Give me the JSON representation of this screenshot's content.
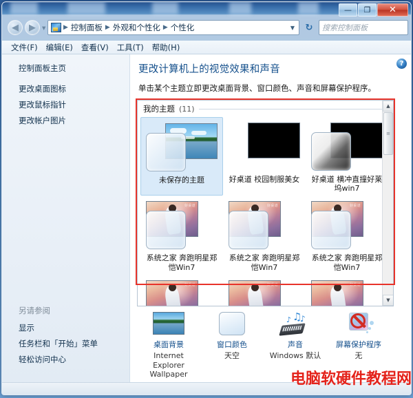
{
  "window": {
    "controls": {
      "minimize": "—",
      "maximize": "❐",
      "close": "✕"
    }
  },
  "addressbar": {
    "back_icon": "back-arrow",
    "forward_icon": "forward-arrow",
    "dropdown_icon": "▼",
    "crumbs": [
      "控制面板",
      "外观和个性化",
      "个性化"
    ],
    "separator": "▶",
    "refresh_icon": "↻"
  },
  "search": {
    "placeholder": "搜索控制面板",
    "value": "",
    "icon": "search-icon"
  },
  "menubar": {
    "items": [
      "文件(F)",
      "编辑(E)",
      "查看(V)",
      "工具(T)",
      "帮助(H)"
    ]
  },
  "sidebar": {
    "home": "控制面板主页",
    "links": [
      "更改桌面图标",
      "更改鼠标指针",
      "更改帐户图片"
    ],
    "see_also_label": "另请参阅",
    "see_also": [
      "显示",
      "任务栏和「开始」菜单",
      "轻松访问中心"
    ]
  },
  "main": {
    "help_icon": "?",
    "title": "更改计算机上的视觉效果和声音",
    "subtitle": "单击某个主题立即更改桌面背景、窗口颜色、声音和屏幕保护程序。",
    "group": {
      "name": "我的主题",
      "count": "(11)"
    },
    "themes": [
      {
        "label": "未保存的主题",
        "thumb": "lake",
        "selected": true,
        "preview": "light",
        "watermark": ""
      },
      {
        "label": "好桌道 校园制服美女",
        "thumb": "black",
        "selected": false,
        "preview": "none",
        "watermark": ""
      },
      {
        "label": "好桌道 横冲直撞好莱坞win7",
        "thumb": "black",
        "selected": false,
        "preview": "dark",
        "watermark": ""
      },
      {
        "label": "系统之家 奔跑明星郑恺Win7",
        "thumb": "star",
        "selected": false,
        "preview": "light",
        "watermark": "好桌道"
      },
      {
        "label": "系统之家 奔跑明星郑恺Win7",
        "thumb": "star",
        "selected": false,
        "preview": "light",
        "watermark": "好桌道"
      },
      {
        "label": "系统之家 奔跑明星郑恺Win7",
        "thumb": "star",
        "selected": false,
        "preview": "light",
        "watermark": "好桌道"
      },
      {
        "label": "",
        "thumb": "star",
        "selected": false,
        "preview": "none",
        "watermark": "好桌道"
      },
      {
        "label": "",
        "thumb": "star",
        "selected": false,
        "preview": "none",
        "watermark": "好桌道"
      },
      {
        "label": "",
        "thumb": "star",
        "selected": false,
        "preview": "none",
        "watermark": "好桌道"
      }
    ],
    "scroll": {
      "up": "▲",
      "down": "▼",
      "grip": "≡"
    }
  },
  "options": [
    {
      "name": "桌面背景",
      "value": "Internet Explorer Wallpaper",
      "icon": "wallpaper-icon"
    },
    {
      "name": "窗口颜色",
      "value": "天空",
      "icon": "window-color-icon"
    },
    {
      "name": "声音",
      "value": "Windows 默认",
      "icon": "sound-icon"
    },
    {
      "name": "屏幕保护程序",
      "value": "无",
      "icon": "screensaver-icon"
    }
  ],
  "watermark": {
    "text": "电脑软硬件教程网",
    "color": "#e4231b"
  },
  "annotation": {
    "color": "#e8332a"
  }
}
